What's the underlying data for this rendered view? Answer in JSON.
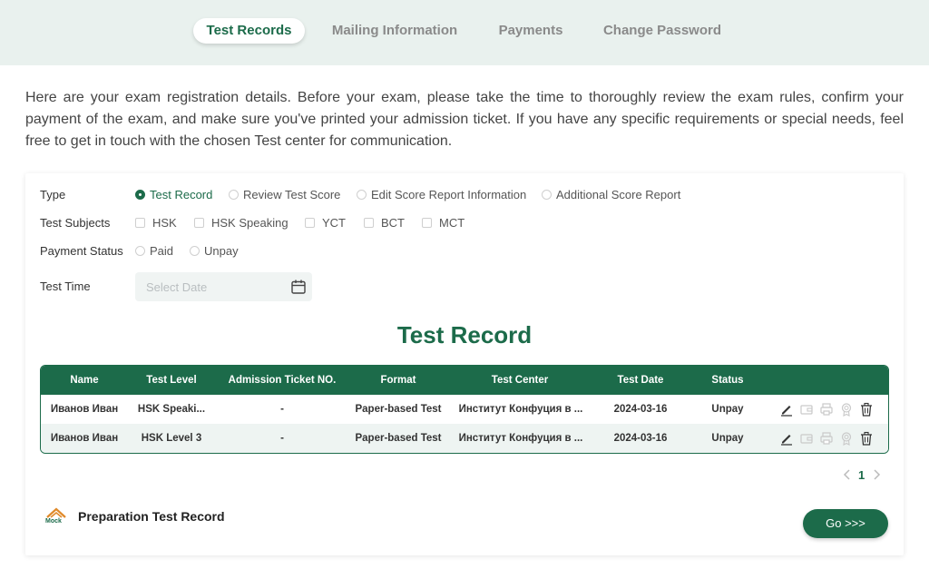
{
  "tabs": [
    {
      "label": "Test Records",
      "active": true
    },
    {
      "label": "Mailing Information",
      "active": false
    },
    {
      "label": "Payments",
      "active": false
    },
    {
      "label": "Change Password",
      "active": false
    }
  ],
  "intro_text": "Here are your exam registration details. Before your exam, please take the time to thoroughly review the exam rules, confirm your payment of the exam, and make sure you've printed your admission ticket. If you have any specific requirements or special needs, feel free to get in touch with the chosen Test center for communication.",
  "filters": {
    "type": {
      "label": "Type",
      "options": [
        "Test Record",
        "Review Test Score",
        "Edit Score Report Information",
        "Additional Score Report"
      ],
      "selected": "Test Record"
    },
    "subjects": {
      "label": "Test Subjects",
      "options": [
        "HSK",
        "HSK Speaking",
        "YCT",
        "BCT",
        "MCT"
      ]
    },
    "payment": {
      "label": "Payment Status",
      "options": [
        "Paid",
        "Unpay"
      ]
    },
    "time": {
      "label": "Test Time",
      "placeholder": "Select Date",
      "icon": "calendar-icon"
    }
  },
  "section_title": "Test Record",
  "table": {
    "headers": [
      "Name",
      "Test Level",
      "Admission Ticket NO.",
      "Format",
      "Test Center",
      "Test Date",
      "Status"
    ],
    "rows": [
      {
        "name": "Иванов Иван",
        "level": "HSK Speaki...",
        "ticket": "-",
        "format": "Paper-based Test",
        "center": "Институт Конфуция в ...",
        "date": "2024-03-16",
        "status": "Unpay"
      },
      {
        "name": "Иванов Иван",
        "level": "HSK Level 3",
        "ticket": "-",
        "format": "Paper-based Test",
        "center": "Институт Конфуция в ...",
        "date": "2024-03-16",
        "status": "Unpay"
      }
    ],
    "action_icons": [
      "edit-icon",
      "wallet-icon",
      "print-icon",
      "certificate-icon",
      "trash-icon"
    ]
  },
  "pagination": {
    "current": "1"
  },
  "preparation": {
    "logo_text": "Mock",
    "title": "Preparation Test Record",
    "button_label": "Go >>>"
  },
  "colors": {
    "primary": "#1c6b4a",
    "topbar_bg": "#e9f1ee"
  }
}
